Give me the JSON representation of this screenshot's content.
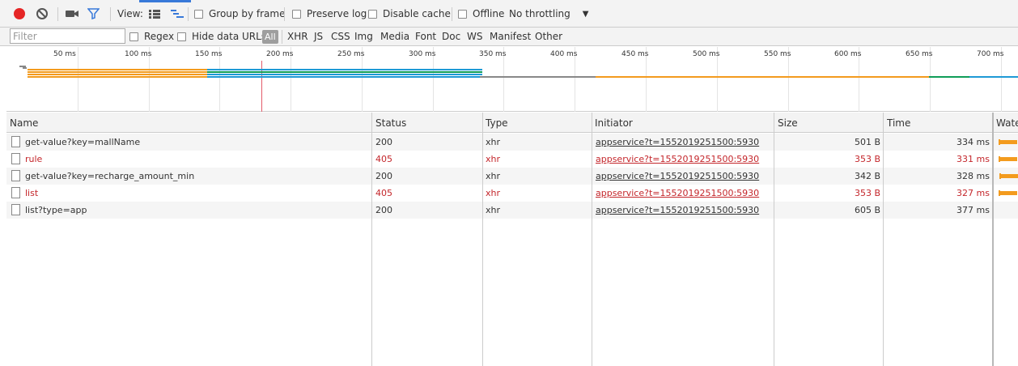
{
  "toolbar": {
    "view_label": "View:",
    "group_by_frame": "Group by frame",
    "preserve_log": "Preserve log",
    "disable_cache": "Disable cache",
    "offline": "Offline",
    "throttling": "No throttling"
  },
  "filterbar": {
    "placeholder": "Filter",
    "regex": "Regex",
    "hide_data_urls": "Hide data URLs",
    "types": [
      "All",
      "XHR",
      "JS",
      "CSS",
      "Img",
      "Media",
      "Font",
      "Doc",
      "WS",
      "Manifest",
      "Other"
    ]
  },
  "overview": {
    "ticks": [
      "50 ms",
      "100 ms",
      "150 ms",
      "200 ms",
      "250 ms",
      "300 ms",
      "350 ms",
      "400 ms",
      "450 ms",
      "500 ms",
      "550 ms",
      "600 ms",
      "650 ms",
      "700 ms"
    ]
  },
  "columns": [
    "Name",
    "Status",
    "Type",
    "Initiator",
    "Size",
    "Time",
    "Waterfall"
  ],
  "columns_visible": [
    "Name",
    "Status",
    "Type",
    "Initiator",
    "Size",
    "Time",
    "Wate"
  ],
  "rows": [
    {
      "name": "get-value?key=mallName",
      "status": "200",
      "type": "xhr",
      "initiator": "appservice?t=1552019251500:5930",
      "size": "501 B",
      "time": "334 ms",
      "error": false
    },
    {
      "name": "rule",
      "status": "405",
      "type": "xhr",
      "initiator": "appservice?t=1552019251500:5930",
      "size": "353 B",
      "time": "331 ms",
      "error": true
    },
    {
      "name": "get-value?key=recharge_amount_min",
      "status": "200",
      "type": "xhr",
      "initiator": "appservice?t=1552019251500:5930",
      "size": "342 B",
      "time": "328 ms",
      "error": false
    },
    {
      "name": "list",
      "status": "405",
      "type": "xhr",
      "initiator": "appservice?t=1552019251500:5930",
      "size": "353 B",
      "time": "327 ms",
      "error": true
    },
    {
      "name": "list?type=app",
      "status": "200",
      "type": "xhr",
      "initiator": "appservice?t=1552019251500:5930",
      "size": "605 B",
      "time": "377 ms",
      "error": false
    }
  ],
  "colors": {
    "record": "#e52525",
    "error_text": "#c4262b",
    "waiting": "#f39b1e",
    "download": "#1e9ad6",
    "stalled": "#0f9d58",
    "selected": "#3879d9"
  }
}
